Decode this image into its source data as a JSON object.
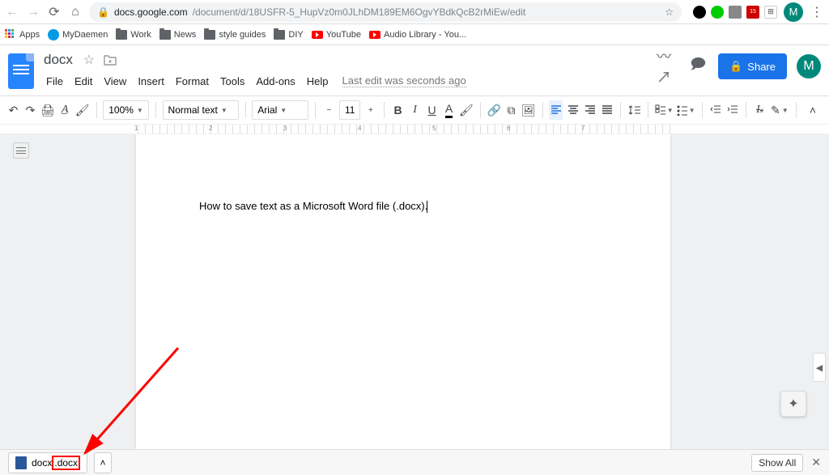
{
  "browser": {
    "url_host": "docs.google.com",
    "url_path": "/document/d/18USFR-5_HupVz0m0JLhDM189EM6OgvYBdkQcB2rMiEw/edit"
  },
  "bookmarks": {
    "apps": "Apps",
    "items": [
      "MyDaemen",
      "Work",
      "News",
      "style guides",
      "DIY",
      "YouTube",
      "Audio Library - You..."
    ]
  },
  "docs": {
    "title": "docx",
    "menus": [
      "File",
      "Edit",
      "View",
      "Insert",
      "Format",
      "Tools",
      "Add-ons",
      "Help"
    ],
    "last_edit": "Last edit was seconds ago",
    "share": "Share",
    "avatar": "M"
  },
  "toolbar": {
    "zoom": "100%",
    "style": "Normal text",
    "font": "Arial",
    "size": "11"
  },
  "ruler": [
    "1",
    "2",
    "3",
    "4",
    "5",
    "6",
    "7"
  ],
  "document": {
    "text": "How to save text as a Microsoft Word file (.docx)."
  },
  "download": {
    "file_prefix": "docx",
    "file_ext": ".docx",
    "show_all": "Show All"
  }
}
